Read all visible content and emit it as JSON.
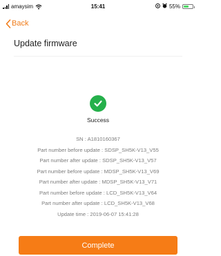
{
  "status_bar": {
    "carrier": "amaysim",
    "time": "15:41",
    "battery": "55%"
  },
  "nav": {
    "back_label": "Back",
    "title": "Update firmware"
  },
  "result": {
    "title": "Success",
    "lines": [
      "SN : A1810160367",
      "Part number before update : SDSP_SH5K-V13_V55",
      "Part number after update : SDSP_SH5K-V13_V57",
      "Part number before update : MDSP_SH5K-V13_V69",
      "Part number after update : MDSP_SH5K-V13_V71",
      "Part number before update : LCD_SH5K-V13_V64",
      "Part number after update : LCD_SH5K-V13_V68",
      "Update time : 2019-06-07 15:41:28"
    ]
  },
  "actions": {
    "complete_label": "Complete"
  },
  "colors": {
    "accent": "#f67c16",
    "success": "#25b04b",
    "secondary_text": "#7d7d7d"
  },
  "icons": {
    "back": "chevron-left-icon",
    "success": "check-circle-icon",
    "wifi": "wifi-icon",
    "location": "location-icon",
    "alarm": "alarm-icon",
    "battery": "battery-icon"
  }
}
